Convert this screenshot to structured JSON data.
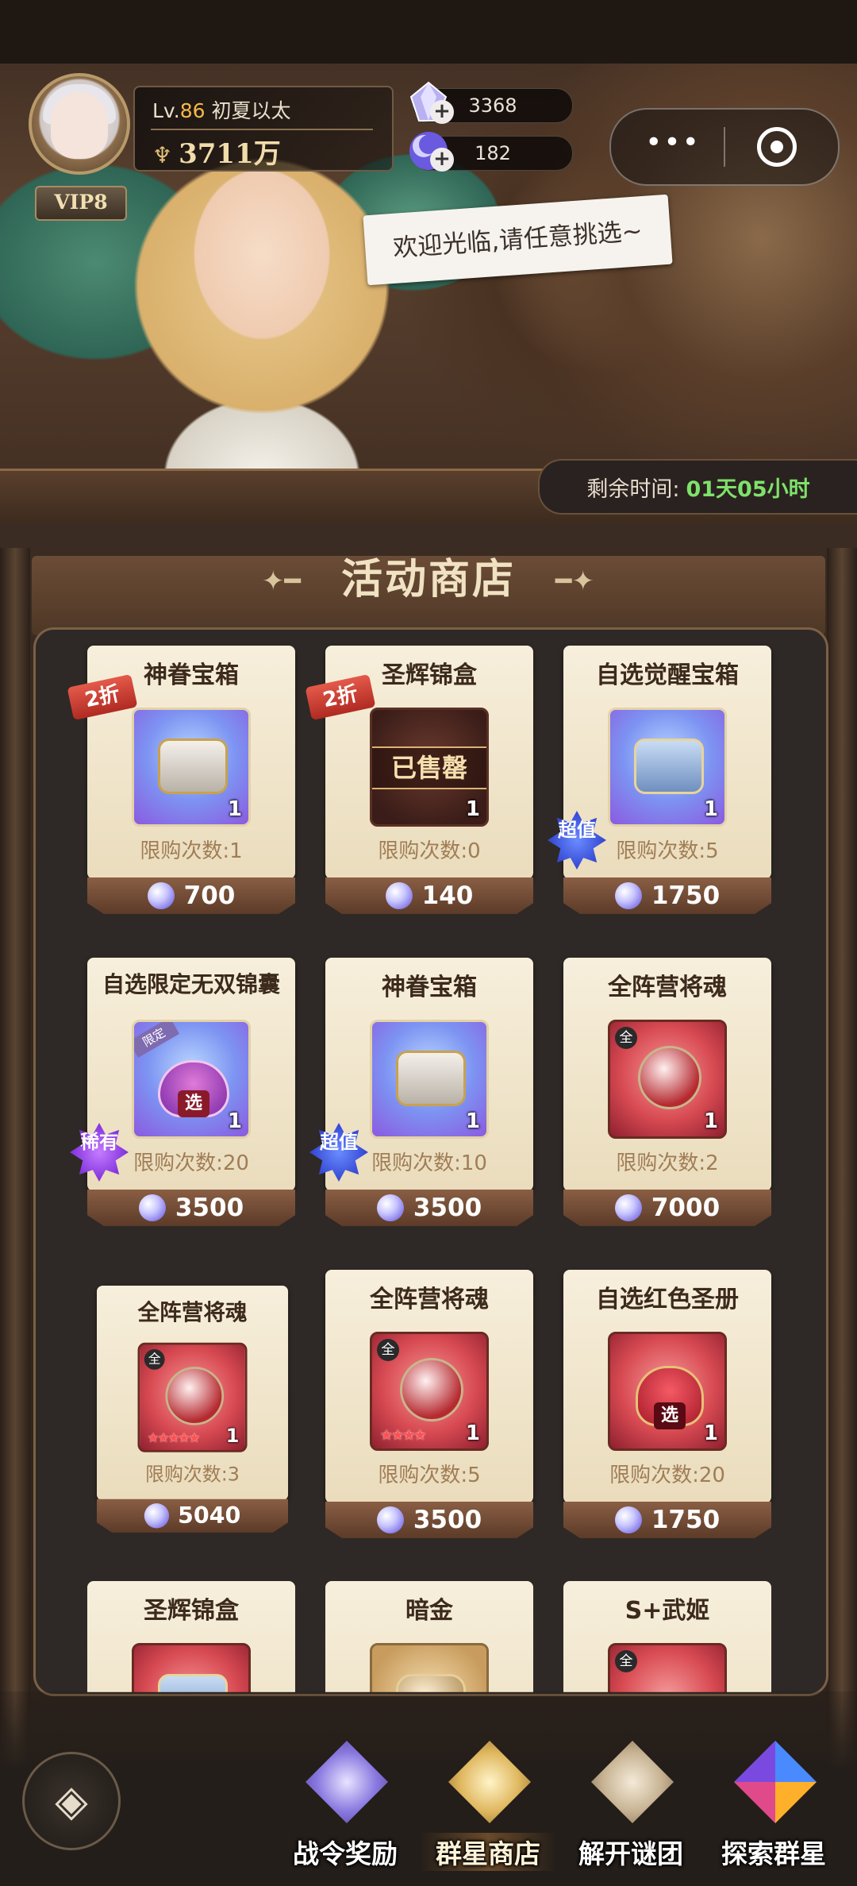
{
  "player": {
    "level_prefix": "Lv.",
    "level": "86",
    "name": "初夏以太",
    "power": "3711万",
    "vip": "VIP8"
  },
  "resources": [
    {
      "icon": "crystal-gem-icon",
      "value": "3368"
    },
    {
      "icon": "moon-orb-icon",
      "value": "182"
    }
  ],
  "mini_program": {
    "menu_icon": "more-dots-icon",
    "close_icon": "target-circle-icon"
  },
  "greeting": "欢迎光临,请任意挑选~",
  "timer": {
    "label": "剩余时间:",
    "value": "01天05小时"
  },
  "shop_title": "活动商店",
  "items": [
    {
      "title": "神眷宝箱",
      "qty": "1",
      "limit": "限购次数:1",
      "price": "700",
      "badge": "2折",
      "tile": "blue"
    },
    {
      "title": "圣辉锦盒",
      "qty": "1",
      "limit": "限购次数:0",
      "price": "140",
      "badge": "2折",
      "sold": "已售罄",
      "tile": "dark"
    },
    {
      "title": "自选觉醒宝箱",
      "qty": "1",
      "limit": "限购次数:5",
      "price": "1750",
      "badge": "超值",
      "tile": "blue"
    },
    {
      "title": "自选限定无双锦囊",
      "qty": "1",
      "limit": "限购次数:20",
      "price": "3500",
      "badge": "稀有",
      "tag": "限定",
      "select": "选",
      "tile": "blue"
    },
    {
      "title": "神眷宝箱",
      "qty": "1",
      "limit": "限购次数:10",
      "price": "3500",
      "badge": "超值",
      "tile": "blue"
    },
    {
      "title": "全阵营将魂",
      "qty": "1",
      "limit": "限购次数:2",
      "price": "7000",
      "tag": "全",
      "tile": "red"
    },
    {
      "title": "全阵营将魂",
      "qty": "1",
      "limit": "限购次数:3",
      "price": "5040",
      "tag": "全",
      "stars": "★★★★★",
      "tile": "red"
    },
    {
      "title": "全阵营将魂",
      "qty": "1",
      "limit": "限购次数:5",
      "price": "3500",
      "tag": "全",
      "stars": "★★★★",
      "tile": "red"
    },
    {
      "title": "自选红色圣册",
      "qty": "1",
      "limit": "限购次数:20",
      "price": "1750",
      "select": "选",
      "tile": "red"
    },
    {
      "title": "圣辉锦盒",
      "tile": "red"
    },
    {
      "title": "暗金",
      "tile": "gold"
    },
    {
      "title": "S+武姬",
      "tag": "全",
      "tile": "red"
    }
  ],
  "nav": [
    {
      "label": "战令奖励",
      "icon": "crystal-reward-icon",
      "active": false
    },
    {
      "label": "群星商店",
      "icon": "star-shop-icon",
      "active": true
    },
    {
      "label": "解开谜团",
      "icon": "mystery-scroll-icon",
      "active": false
    },
    {
      "label": "探索群星",
      "icon": "explore-gems-icon",
      "active": false
    }
  ],
  "colors": {
    "timer_value": "#7ee26a",
    "level_number": "#f4b84a",
    "price_bar": "#6e4a34",
    "card_bg": "#f3e9d2"
  }
}
